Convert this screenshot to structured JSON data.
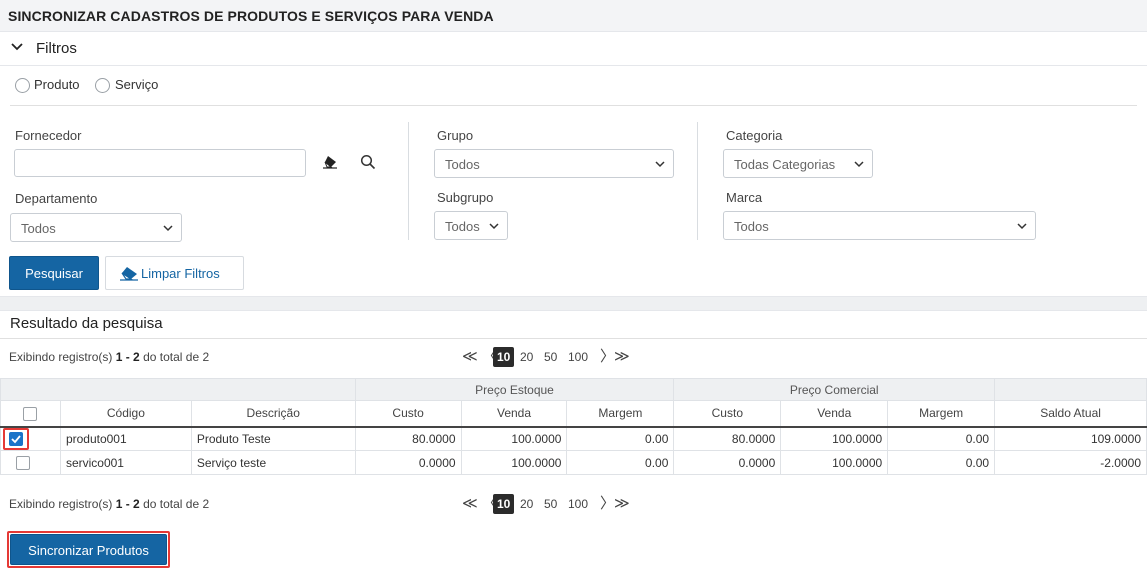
{
  "title": "SINCRONIZAR CADASTROS DE PRODUTOS E SERVIÇOS PARA VENDA",
  "filters": {
    "header": "Filtros",
    "radios": [
      {
        "label": "Produto",
        "checked": false
      },
      {
        "label": "Serviço",
        "checked": false
      }
    ],
    "fornecedor": {
      "label": "Fornecedor",
      "value": ""
    },
    "departamento": {
      "label": "Departamento",
      "value": "Todos"
    },
    "grupo": {
      "label": "Grupo",
      "value": "Todos"
    },
    "subgrupo": {
      "label": "Subgrupo",
      "value": "Todos"
    },
    "categoria": {
      "label": "Categoria",
      "value": "Todas Categorias"
    },
    "marca": {
      "label": "Marca",
      "value": "Todos"
    },
    "pesquisar_label": "Pesquisar",
    "limpar_label": "Limpar Filtros"
  },
  "results": {
    "title": "Resultado da pesquisa",
    "info_prefix": "Exibindo registro(s) ",
    "info_range": "1 - 2",
    "info_suffix": " do total de 2",
    "page_sizes": [
      "10",
      "20",
      "50",
      "100"
    ],
    "active_page_size": "10",
    "group_headers": {
      "estoque": "Preço Estoque",
      "comercial": "Preço Comercial"
    },
    "columns": [
      "Código",
      "Descrição",
      "Custo",
      "Venda",
      "Margem",
      "Custo",
      "Venda",
      "Margem",
      "Saldo Atual"
    ],
    "rows": [
      {
        "checked": true,
        "codigo": "produto001",
        "descricao": "Produto Teste",
        "custo_est": "80.0000",
        "venda_est": "100.0000",
        "margem_est": "0.00",
        "custo_com": "80.0000",
        "venda_com": "100.0000",
        "margem_com": "0.00",
        "saldo": "109.0000"
      },
      {
        "checked": false,
        "codigo": "servico001",
        "descricao": "Serviço teste",
        "custo_est": "0.0000",
        "venda_est": "100.0000",
        "margem_est": "0.00",
        "custo_com": "0.0000",
        "venda_com": "100.0000",
        "margem_com": "0.00",
        "saldo": "-2.0000"
      }
    ],
    "sync_label": "Sincronizar Produtos"
  },
  "colors": {
    "primary": "#1565a3",
    "highlight": "#e53935",
    "checkbox": "#1a73c8"
  }
}
